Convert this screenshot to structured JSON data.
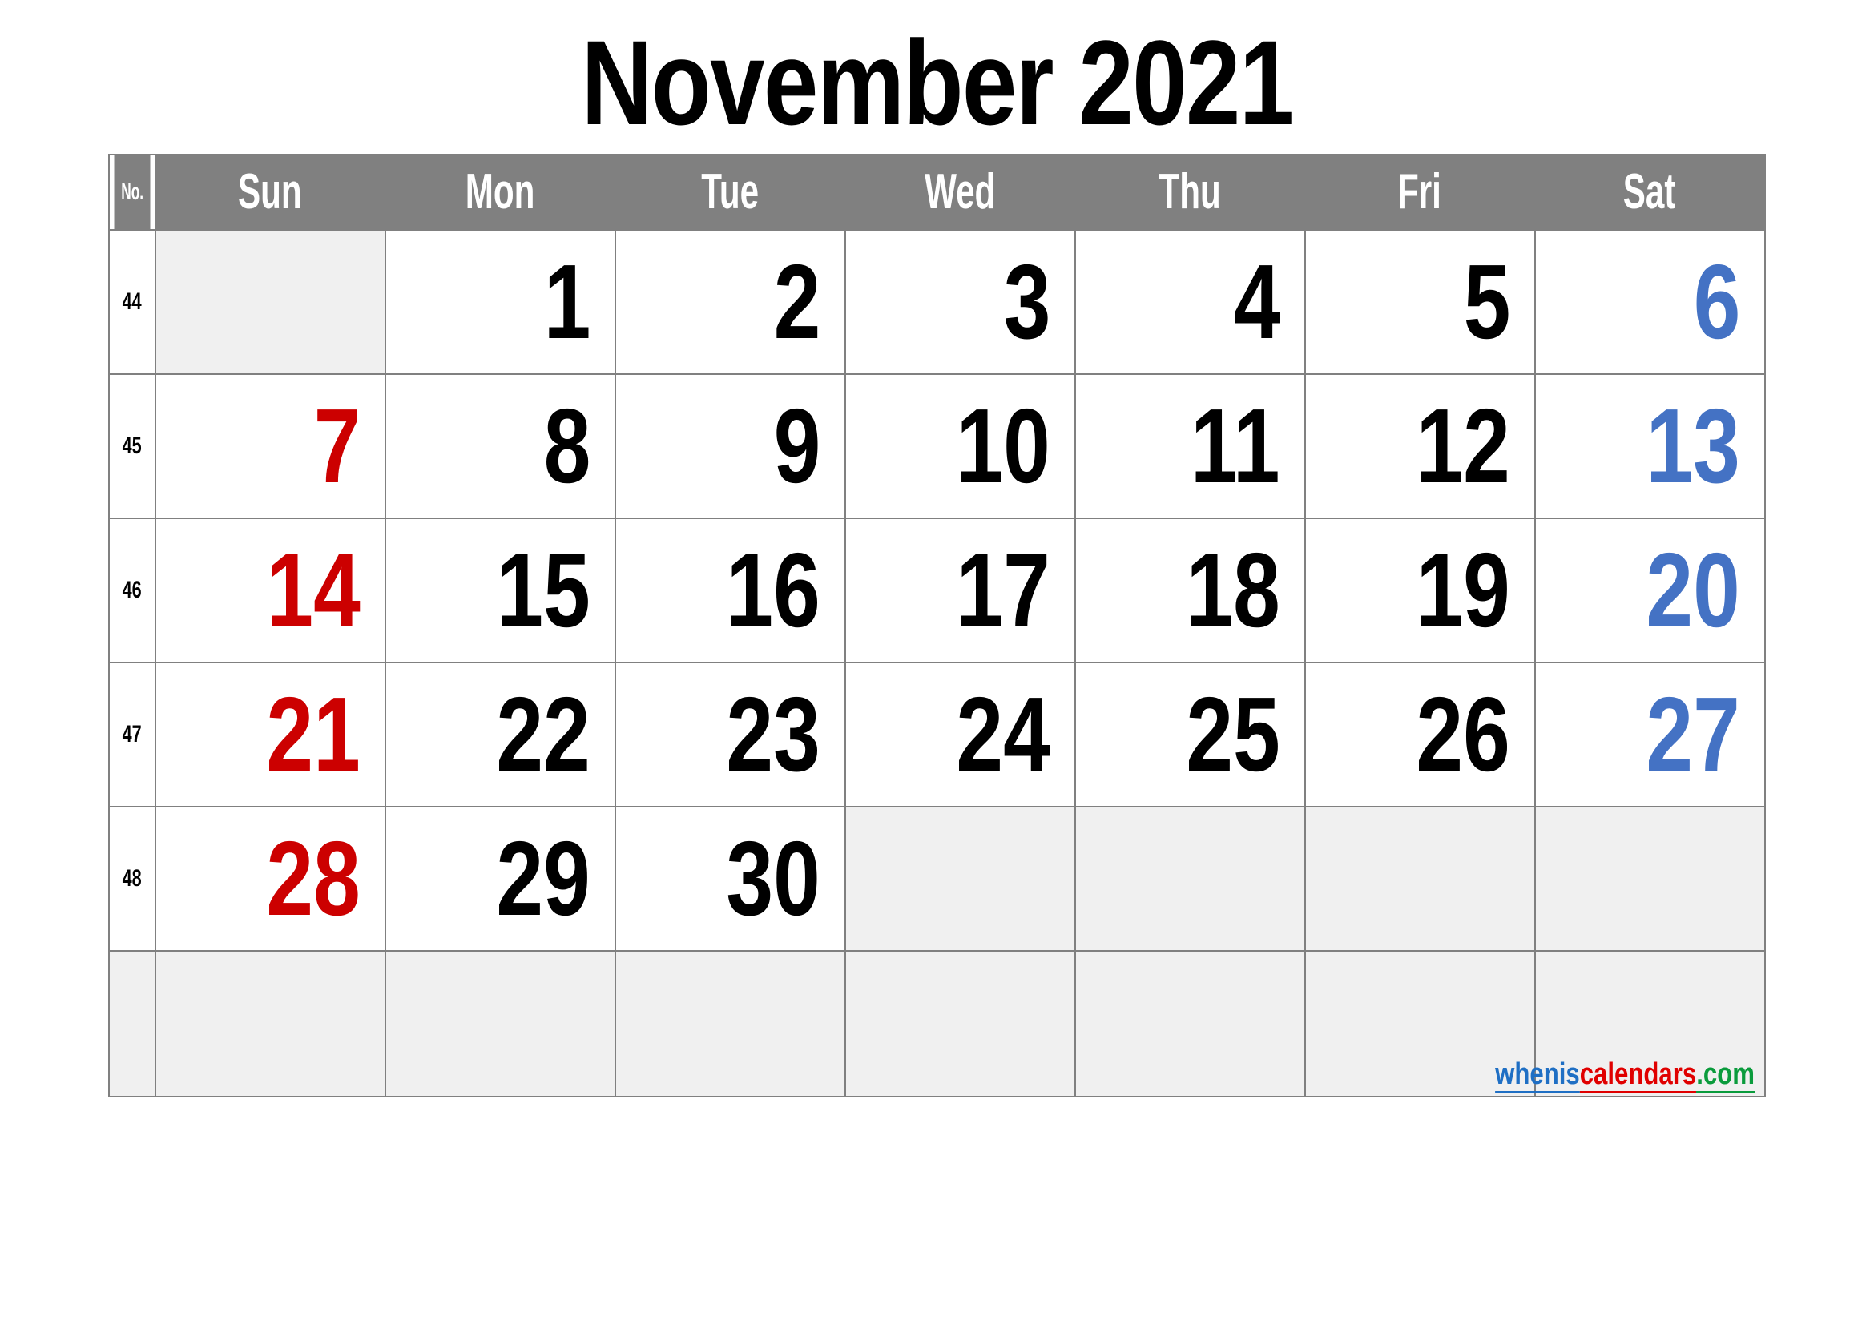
{
  "title": "November 2021",
  "header": {
    "week_label": "No.",
    "days": [
      "Sun",
      "Mon",
      "Tue",
      "Wed",
      "Thu",
      "Fri",
      "Sat"
    ]
  },
  "colors": {
    "header_bg": "#808080",
    "grid_line": "#808080",
    "empty_cell": "#f0f0f0",
    "sunday": "#CC0000",
    "saturday": "#4472C4",
    "weekday": "#000000"
  },
  "weeks": [
    {
      "number": "44",
      "days": [
        {
          "value": "",
          "kind": "empty"
        },
        {
          "value": "1",
          "kind": "weekday"
        },
        {
          "value": "2",
          "kind": "weekday"
        },
        {
          "value": "3",
          "kind": "weekday"
        },
        {
          "value": "4",
          "kind": "weekday"
        },
        {
          "value": "5",
          "kind": "weekday"
        },
        {
          "value": "6",
          "kind": "saturday"
        }
      ]
    },
    {
      "number": "45",
      "days": [
        {
          "value": "7",
          "kind": "sunday"
        },
        {
          "value": "8",
          "kind": "weekday"
        },
        {
          "value": "9",
          "kind": "weekday"
        },
        {
          "value": "10",
          "kind": "weekday"
        },
        {
          "value": "11",
          "kind": "weekday"
        },
        {
          "value": "12",
          "kind": "weekday"
        },
        {
          "value": "13",
          "kind": "saturday"
        }
      ]
    },
    {
      "number": "46",
      "days": [
        {
          "value": "14",
          "kind": "sunday"
        },
        {
          "value": "15",
          "kind": "weekday"
        },
        {
          "value": "16",
          "kind": "weekday"
        },
        {
          "value": "17",
          "kind": "weekday"
        },
        {
          "value": "18",
          "kind": "weekday"
        },
        {
          "value": "19",
          "kind": "weekday"
        },
        {
          "value": "20",
          "kind": "saturday"
        }
      ]
    },
    {
      "number": "47",
      "days": [
        {
          "value": "21",
          "kind": "sunday"
        },
        {
          "value": "22",
          "kind": "weekday"
        },
        {
          "value": "23",
          "kind": "weekday"
        },
        {
          "value": "24",
          "kind": "weekday"
        },
        {
          "value": "25",
          "kind": "weekday"
        },
        {
          "value": "26",
          "kind": "weekday"
        },
        {
          "value": "27",
          "kind": "saturday"
        }
      ]
    },
    {
      "number": "48",
      "days": [
        {
          "value": "28",
          "kind": "sunday"
        },
        {
          "value": "29",
          "kind": "weekday"
        },
        {
          "value": "30",
          "kind": "weekday"
        },
        {
          "value": "",
          "kind": "empty"
        },
        {
          "value": "",
          "kind": "empty"
        },
        {
          "value": "",
          "kind": "empty"
        },
        {
          "value": "",
          "kind": "empty"
        }
      ]
    },
    {
      "number": "",
      "days": [
        {
          "value": "",
          "kind": "empty"
        },
        {
          "value": "",
          "kind": "empty"
        },
        {
          "value": "",
          "kind": "empty"
        },
        {
          "value": "",
          "kind": "empty"
        },
        {
          "value": "",
          "kind": "empty"
        },
        {
          "value": "",
          "kind": "empty"
        },
        {
          "value": "",
          "kind": "empty"
        }
      ]
    }
  ],
  "watermark": {
    "part1": "whenis",
    "part2": "calendars",
    "part3": ".com"
  }
}
